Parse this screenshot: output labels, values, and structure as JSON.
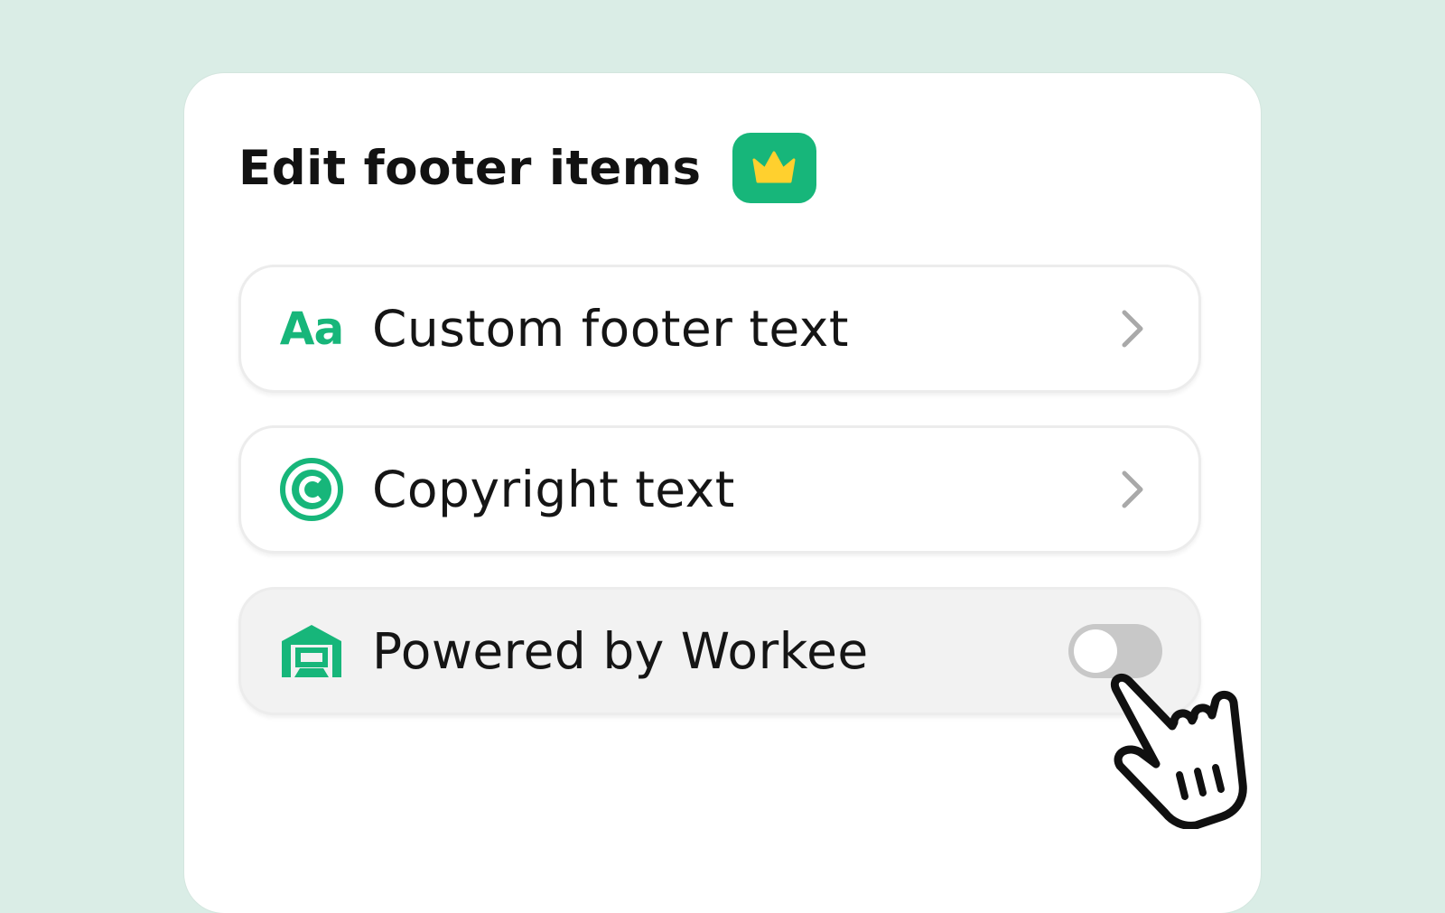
{
  "panel": {
    "title": "Edit footer items",
    "badge_icon": "crown-icon",
    "accent_color": "#17b67a"
  },
  "items": [
    {
      "icon": "text-format-icon",
      "icon_text": "Aa",
      "label": "Custom footer text",
      "control": "chevron-right-icon"
    },
    {
      "icon": "copyright-icon",
      "label": "Copyright text",
      "control": "chevron-right-icon"
    },
    {
      "icon": "workee-logo-icon",
      "label": "Powered by Workee",
      "control": "toggle",
      "toggle_on": false
    }
  ],
  "cursor": "hand-pointer-icon"
}
